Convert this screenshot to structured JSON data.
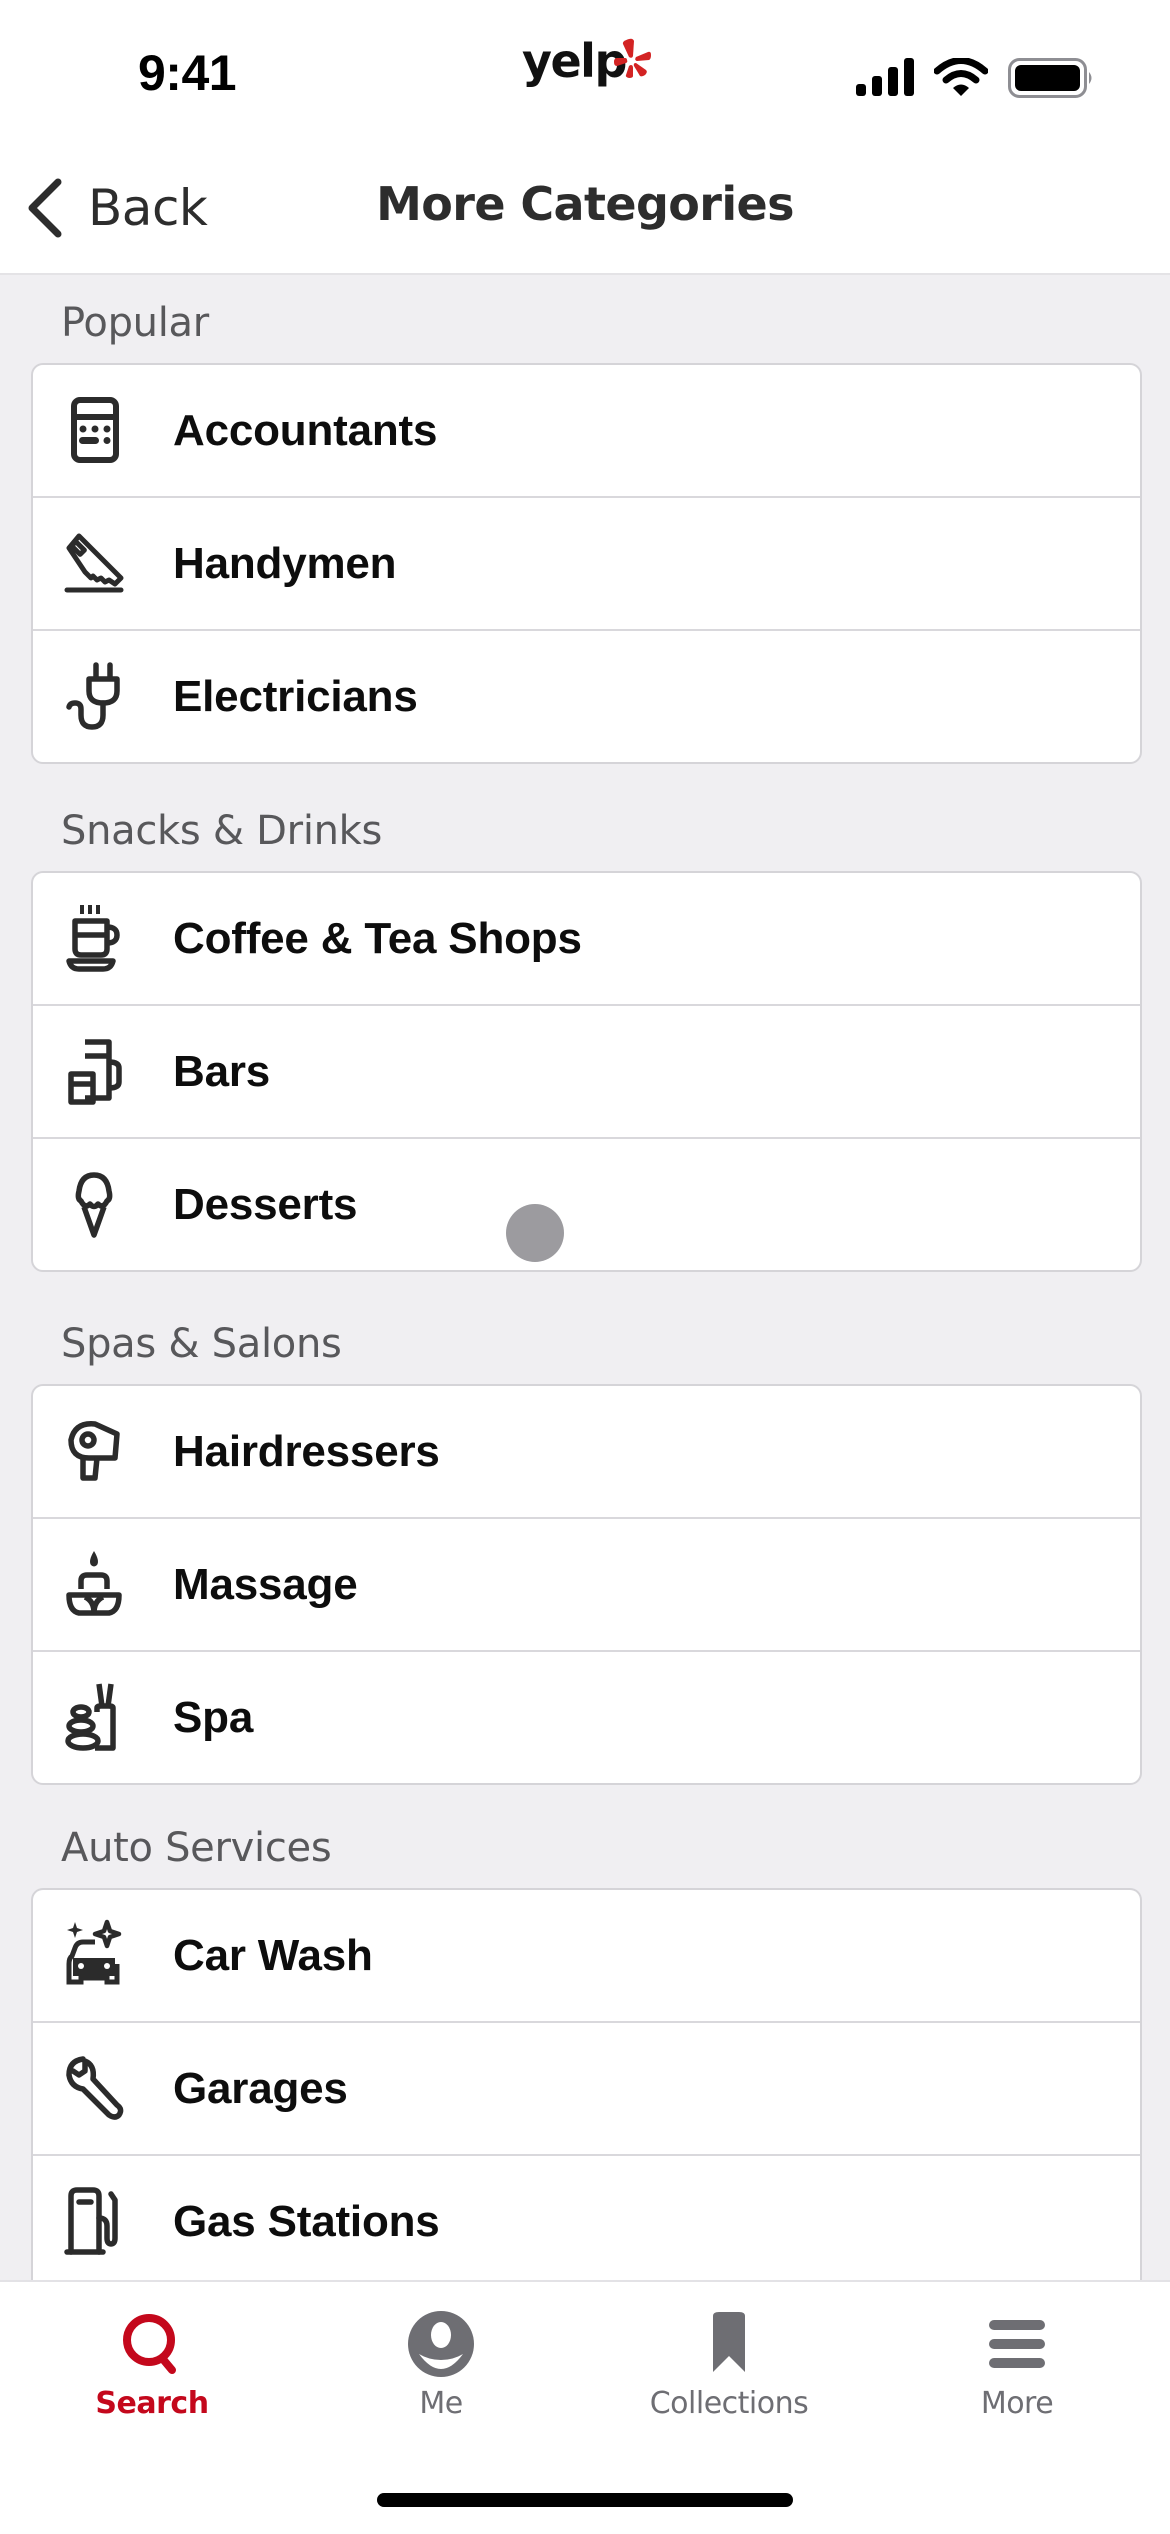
{
  "status_bar": {
    "time": "9:41",
    "logo_text": "yelp",
    "brand_color": "#d32323",
    "icons": [
      "cellular-signal-icon",
      "wifi-icon",
      "battery-icon"
    ]
  },
  "nav": {
    "back_label": "Back",
    "title": "More Categories"
  },
  "sections": [
    {
      "header": "Popular",
      "items": [
        {
          "label": "Accountants",
          "icon": "calculator-icon"
        },
        {
          "label": "Handymen",
          "icon": "saw-icon"
        },
        {
          "label": "Electricians",
          "icon": "plug-icon"
        }
      ]
    },
    {
      "header": "Snacks & Drinks",
      "items": [
        {
          "label": "Coffee & Tea Shops",
          "icon": "coffee-cup-icon"
        },
        {
          "label": "Bars",
          "icon": "drinks-icon"
        },
        {
          "label": "Desserts",
          "icon": "ice-cream-icon"
        }
      ]
    },
    {
      "header": "Spas & Salons",
      "items": [
        {
          "label": "Hairdressers",
          "icon": "hair-dryer-icon"
        },
        {
          "label": "Massage",
          "icon": "candle-lotus-icon"
        },
        {
          "label": "Spa",
          "icon": "spa-stones-icon"
        }
      ]
    },
    {
      "header": "Auto Services",
      "items": [
        {
          "label": "Car Wash",
          "icon": "car-sparkle-icon"
        },
        {
          "label": "Garages",
          "icon": "wrench-icon"
        },
        {
          "label": "Gas Stations",
          "icon": "gas-pump-icon"
        }
      ]
    }
  ],
  "tab_bar": {
    "active_color": "#c4081c",
    "inactive_color": "#6e6e73",
    "tabs": [
      {
        "label": "Search",
        "icon": "search-icon",
        "active": true
      },
      {
        "label": "Me",
        "icon": "user-icon",
        "active": false
      },
      {
        "label": "Collections",
        "icon": "bookmark-icon",
        "active": false
      },
      {
        "label": "More",
        "icon": "menu-icon",
        "active": false
      }
    ]
  }
}
